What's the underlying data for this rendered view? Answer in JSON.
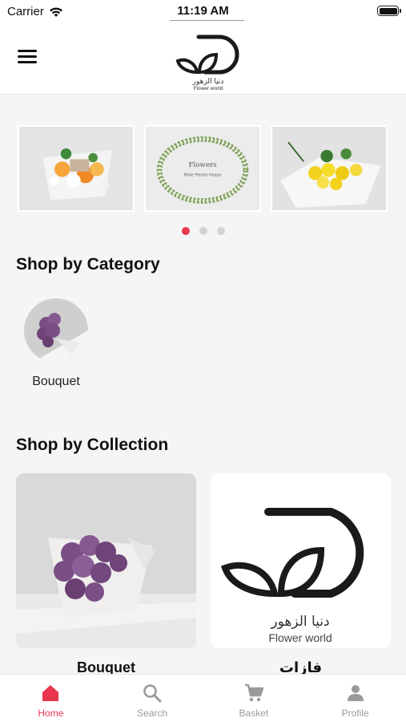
{
  "status_bar": {
    "carrier": "Carrier",
    "time": "11:19 AM"
  },
  "header": {
    "logo_arabic": "دنيا الزهور",
    "logo_english": "Flower world"
  },
  "carousel": {
    "slides": [
      "slide-1",
      "slide-2",
      "slide-3"
    ],
    "slide2_text_top": "Flowers",
    "slide2_text_bottom": "Make People Happy",
    "active_index": 0
  },
  "shop_by_category": {
    "title": "Shop by Category",
    "items": [
      {
        "label": "Bouquet"
      }
    ]
  },
  "shop_by_collection": {
    "title": "Shop by Collection",
    "items": [
      {
        "label": "Bouquet"
      },
      {
        "label": "فازات"
      }
    ],
    "logo_arabic": "دنيا الزهور",
    "logo_english": "Flower world"
  },
  "tabbar": {
    "tabs": [
      {
        "label": "Home",
        "icon": "home-icon",
        "active": true
      },
      {
        "label": "Search",
        "icon": "search-icon",
        "active": false
      },
      {
        "label": "Basket",
        "icon": "cart-icon",
        "active": false
      },
      {
        "label": "Profile",
        "icon": "person-icon",
        "active": false
      }
    ]
  },
  "colors": {
    "accent": "#e8364f",
    "inactive": "#9a9a9a",
    "rose": "#7a4f86"
  }
}
